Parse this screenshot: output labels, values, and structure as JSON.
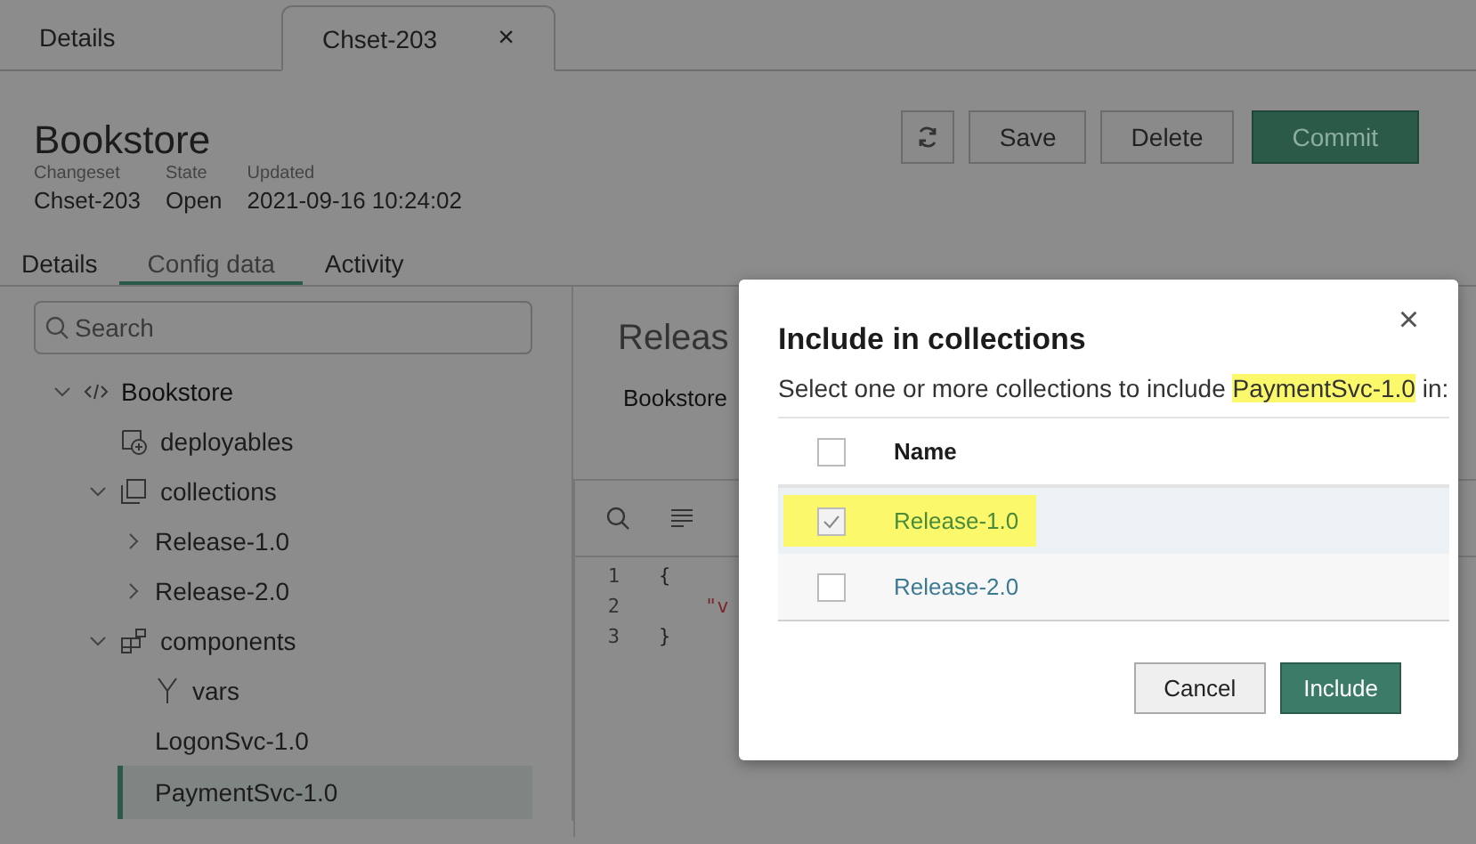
{
  "top_tabs": [
    {
      "label": "Details",
      "selected": false
    },
    {
      "label": "Chset-203",
      "selected": true,
      "close": "×"
    }
  ],
  "header": {
    "title": "Bookstore",
    "meta": [
      {
        "label": "Changeset",
        "value": "Chset-203"
      },
      {
        "label": "State",
        "value": "Open"
      },
      {
        "label": "Updated",
        "value": "2021-09-16 10:24:02"
      }
    ],
    "buttons": [
      {
        "kind": "refresh"
      },
      {
        "kind": "secondary",
        "label": "Save"
      },
      {
        "kind": "secondary",
        "label": "Delete"
      },
      {
        "kind": "primary",
        "label": "Commit"
      }
    ]
  },
  "sub_tabs": [
    {
      "label": "Details",
      "selected": false
    },
    {
      "label": "Config data",
      "selected": true
    },
    {
      "label": "Activity",
      "selected": false
    }
  ],
  "sidebar": {
    "search": {
      "placeholder": "Search"
    },
    "tree": [
      {
        "label": "Bookstore",
        "kind": "code",
        "expanded": true,
        "selected": false,
        "children": [
          {
            "label": "deployables",
            "kind": "deployables",
            "selected": false
          },
          {
            "label": "collections",
            "kind": "collections",
            "expanded": true,
            "selected": false,
            "children": [
              {
                "label": "Release-1.0",
                "expanded": false,
                "selected": false
              },
              {
                "label": "Release-2.0",
                "expanded": false,
                "selected": false
              }
            ]
          },
          {
            "label": "components",
            "kind": "components",
            "expanded": true,
            "selected": false,
            "children": [
              {
                "label": "vars",
                "kind": "vars",
                "selected": false
              },
              {
                "label": "LogonSvc-1.0",
                "selected": false
              },
              {
                "label": "PaymentSvc-1.0",
                "selected": true
              }
            ]
          }
        ]
      }
    ]
  },
  "content": {
    "title": "Releas",
    "breadcrumb": "Bookstore",
    "editor": {
      "lines": [
        {
          "number": "1",
          "text": "{"
        },
        {
          "number": "2",
          "text": "\"v"
        },
        {
          "number": "3",
          "text": "}"
        }
      ]
    }
  },
  "dialog": {
    "title": "Include in collections",
    "close": "×",
    "description": [
      {
        "text": "Select one or more collections to include ",
        "highlighted": false
      },
      {
        "text": "PaymentSvc-1.0",
        "highlighted": true
      },
      {
        "text": " in:",
        "highlighted": false
      }
    ],
    "table": {
      "header_checked": false,
      "column": "Name",
      "rows": [
        {
          "name": "Release-1.0",
          "checked": true,
          "selected": true,
          "highlighted": true
        },
        {
          "name": "Release-2.0",
          "checked": false,
          "selected": false,
          "highlighted": false
        }
      ]
    },
    "buttons": [
      {
        "kind": "secondary",
        "label": "Cancel"
      },
      {
        "kind": "primary",
        "label": "Include"
      }
    ]
  }
}
